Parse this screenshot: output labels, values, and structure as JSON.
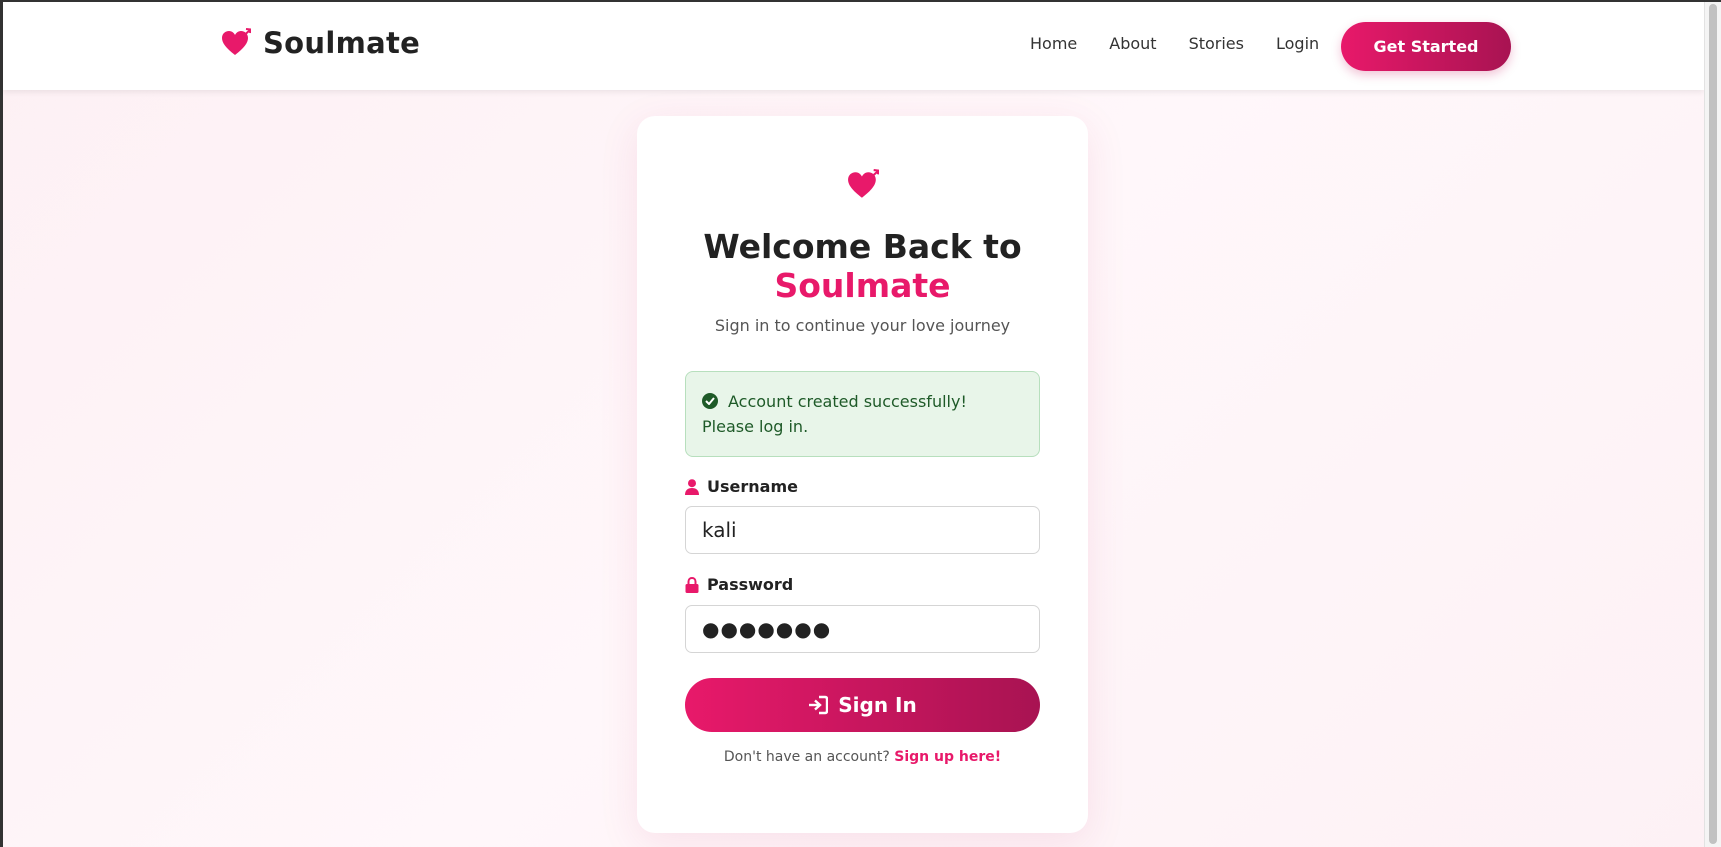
{
  "navbar": {
    "brand": "Soulmate",
    "links": [
      "Home",
      "About",
      "Stories",
      "Login"
    ],
    "cta": "Get Started"
  },
  "card": {
    "title_line1": "Welcome Back to",
    "title_line2": "Soulmate",
    "subtitle": "Sign in to continue your love journey",
    "alert": "Account created successfully! Please log in.",
    "username": {
      "label": "Username",
      "value": "kali"
    },
    "password": {
      "label": "Password",
      "value": "●●●●●●●"
    },
    "submit": "Sign In",
    "signup_prompt": "Don't have an account?",
    "signup_link": "Sign up here!"
  },
  "colors": {
    "accent": "#e8196a",
    "accent_dark": "#a81352",
    "success_bg": "#e8f5e9",
    "success_text": "#1e5a28"
  },
  "icons": [
    "heart-arrow-icon",
    "check-circle-icon",
    "user-icon",
    "lock-icon",
    "sign-in-icon"
  ]
}
